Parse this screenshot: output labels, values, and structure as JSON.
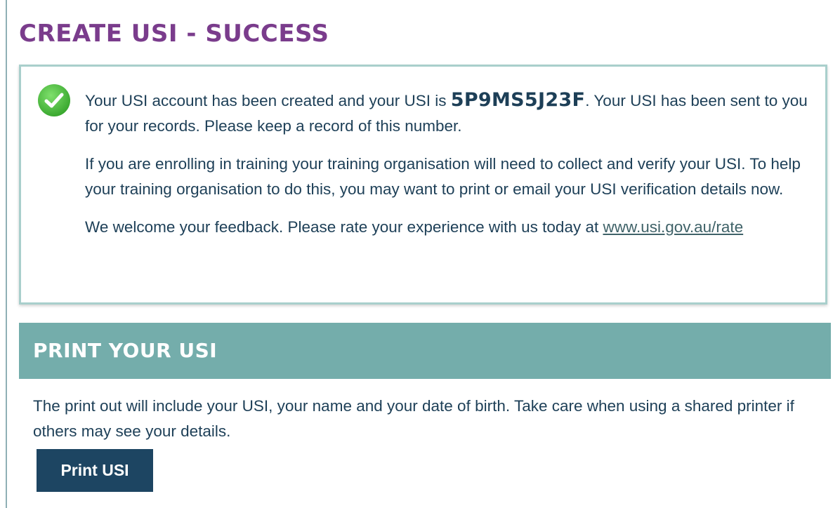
{
  "page": {
    "title": "CREATE USI - SUCCESS"
  },
  "success_message": {
    "icon": "check-circle-icon",
    "icon_color": "#4cbf3f",
    "intro_prefix": "Your USI account has been created and your USI is ",
    "usi_number": "5P9MS5J23F",
    "intro_suffix": ". Your USI has been sent to you for your records. Please keep a record of this number.",
    "enrolling_paragraph": "If you are enrolling in training your training organisation will need to collect and verify your USI. To help your training organisation to do this, you may want to print or email your USI verification details now.",
    "feedback_prefix": "We welcome your feedback. Please rate your experience with us today at ",
    "feedback_link": "www.usi.gov.au/rate"
  },
  "print_section": {
    "heading": "PRINT YOUR USI",
    "description": "The print out will include your USI, your name and your date of birth. Take care when using a shared printer if others may see your details.",
    "button_label": "Print USI"
  },
  "colors": {
    "title": "#7a3c8c",
    "text": "#1d3f57",
    "section_header_bg": "#74adab",
    "box_border": "#a9cfcc",
    "button_bg": "#1d4562"
  }
}
